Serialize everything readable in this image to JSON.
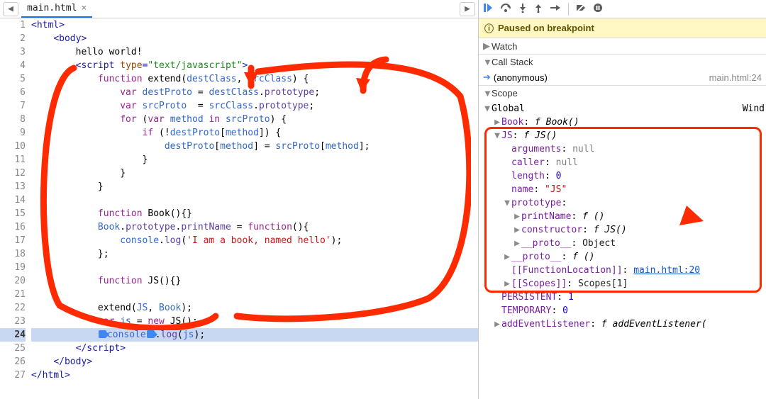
{
  "tab": {
    "filename": "main.html"
  },
  "banner": {
    "text": "Paused on breakpoint"
  },
  "sections": {
    "watch": "Watch",
    "callstack": "Call Stack",
    "scope": "Scope"
  },
  "callstack": {
    "frame_name": "(anonymous)",
    "frame_loc": "main.html:24"
  },
  "code": {
    "active_line": 24,
    "lines": [
      {
        "n": 1,
        "tokens": [
          [
            "c-tag",
            "<html>"
          ]
        ]
      },
      {
        "n": 2,
        "indent": 1,
        "tokens": [
          [
            "c-tag",
            "<body>"
          ]
        ]
      },
      {
        "n": 3,
        "indent": 2,
        "tokens": [
          [
            "c-pl",
            "hello world!"
          ]
        ]
      },
      {
        "n": 4,
        "indent": 2,
        "tokens": [
          [
            "c-tag",
            "<script "
          ],
          [
            "c-attr",
            "type"
          ],
          [
            "c-tag",
            "="
          ],
          [
            "c-str",
            "\"text/javascript\""
          ],
          [
            "c-tag",
            ">"
          ]
        ]
      },
      {
        "n": 5,
        "indent": 3,
        "tokens": [
          [
            "c-kw",
            "function "
          ],
          [
            "c-fn",
            "extend"
          ],
          [
            "c-pl",
            "("
          ],
          [
            "c-var",
            "destClass"
          ],
          [
            "c-pl",
            ", "
          ],
          [
            "c-var",
            "srcClass"
          ],
          [
            "c-pl",
            ") {"
          ]
        ]
      },
      {
        "n": 6,
        "indent": 4,
        "tokens": [
          [
            "c-kw",
            "var "
          ],
          [
            "c-var",
            "destProto"
          ],
          [
            "c-pl",
            " = "
          ],
          [
            "c-var",
            "destClass"
          ],
          [
            "c-pl",
            "."
          ],
          [
            "c-prop",
            "prototype"
          ],
          [
            "c-pl",
            ";"
          ]
        ]
      },
      {
        "n": 7,
        "indent": 4,
        "tokens": [
          [
            "c-kw",
            "var "
          ],
          [
            "c-var",
            "srcProto"
          ],
          [
            "c-pl",
            "  = "
          ],
          [
            "c-var",
            "srcClass"
          ],
          [
            "c-pl",
            "."
          ],
          [
            "c-prop",
            "prototype"
          ],
          [
            "c-pl",
            ";"
          ]
        ]
      },
      {
        "n": 8,
        "indent": 4,
        "tokens": [
          [
            "c-kw",
            "for "
          ],
          [
            "c-pl",
            "("
          ],
          [
            "c-kw",
            "var "
          ],
          [
            "c-var",
            "method"
          ],
          [
            "c-kw",
            " in "
          ],
          [
            "c-var",
            "srcProto"
          ],
          [
            "c-pl",
            ") {"
          ]
        ]
      },
      {
        "n": 9,
        "indent": 5,
        "tokens": [
          [
            "c-kw",
            "if "
          ],
          [
            "c-pl",
            "(!"
          ],
          [
            "c-var",
            "destProto"
          ],
          [
            "c-pl",
            "["
          ],
          [
            "c-var",
            "method"
          ],
          [
            "c-pl",
            "]) {"
          ]
        ]
      },
      {
        "n": 10,
        "indent": 6,
        "tokens": [
          [
            "c-var",
            "destProto"
          ],
          [
            "c-pl",
            "["
          ],
          [
            "c-var",
            "method"
          ],
          [
            "c-pl",
            "] = "
          ],
          [
            "c-var",
            "srcProto"
          ],
          [
            "c-pl",
            "["
          ],
          [
            "c-var",
            "method"
          ],
          [
            "c-pl",
            "];"
          ]
        ]
      },
      {
        "n": 11,
        "indent": 5,
        "tokens": [
          [
            "c-pl",
            "}"
          ]
        ]
      },
      {
        "n": 12,
        "indent": 4,
        "tokens": [
          [
            "c-pl",
            "}"
          ]
        ]
      },
      {
        "n": 13,
        "indent": 3,
        "tokens": [
          [
            "c-pl",
            "}"
          ]
        ]
      },
      {
        "n": 14,
        "indent": 0,
        "tokens": []
      },
      {
        "n": 15,
        "indent": 3,
        "tokens": [
          [
            "c-kw",
            "function "
          ],
          [
            "c-fn",
            "Book"
          ],
          [
            "c-pl",
            "(){}"
          ]
        ]
      },
      {
        "n": 16,
        "indent": 3,
        "tokens": [
          [
            "c-var",
            "Book"
          ],
          [
            "c-pl",
            "."
          ],
          [
            "c-prop",
            "prototype"
          ],
          [
            "c-pl",
            "."
          ],
          [
            "c-prop",
            "printName"
          ],
          [
            "c-pl",
            " = "
          ],
          [
            "c-kw",
            "function"
          ],
          [
            "c-pl",
            "(){"
          ]
        ]
      },
      {
        "n": 17,
        "indent": 4,
        "tokens": [
          [
            "c-var",
            "console"
          ],
          [
            "c-pl",
            "."
          ],
          [
            "c-prop",
            "log"
          ],
          [
            "c-pl",
            "("
          ],
          [
            "c-sstr",
            "'I am a book, named hello'"
          ],
          [
            "c-pl",
            ");"
          ]
        ]
      },
      {
        "n": 18,
        "indent": 3,
        "tokens": [
          [
            "c-pl",
            "};"
          ]
        ]
      },
      {
        "n": 19,
        "indent": 0,
        "tokens": []
      },
      {
        "n": 20,
        "indent": 3,
        "tokens": [
          [
            "c-kw",
            "function "
          ],
          [
            "c-fn",
            "JS"
          ],
          [
            "c-pl",
            "(){}"
          ]
        ]
      },
      {
        "n": 21,
        "indent": 0,
        "tokens": []
      },
      {
        "n": 22,
        "indent": 3,
        "tokens": [
          [
            "c-fn",
            "extend"
          ],
          [
            "c-pl",
            "("
          ],
          [
            "c-var",
            "JS"
          ],
          [
            "c-pl",
            ", "
          ],
          [
            "c-var",
            "Book"
          ],
          [
            "c-pl",
            ");"
          ]
        ]
      },
      {
        "n": 23,
        "indent": 3,
        "tokens": [
          [
            "c-kw",
            "var "
          ],
          [
            "c-var",
            "js"
          ],
          [
            "c-pl",
            " = "
          ],
          [
            "c-kw",
            "new "
          ],
          [
            "c-fn",
            "JS"
          ],
          [
            "c-pl",
            "();"
          ]
        ]
      },
      {
        "n": 24,
        "indent": 3,
        "bp": true,
        "tokens": [
          [
            "c-var",
            "console"
          ],
          [
            "c-pl",
            "."
          ],
          [
            "c-prop",
            "log"
          ],
          [
            "c-pl",
            "("
          ],
          [
            "c-var",
            "js"
          ],
          [
            "c-pl",
            ");"
          ]
        ]
      },
      {
        "n": 25,
        "indent": 2,
        "tokens": [
          [
            "c-tag",
            "</script"
          ],
          [
            "c-tag",
            ">"
          ]
        ]
      },
      {
        "n": 26,
        "indent": 1,
        "tokens": [
          [
            "c-tag",
            "</body>"
          ]
        ]
      },
      {
        "n": 27,
        "indent": 0,
        "tokens": [
          [
            "c-tag",
            "</html>"
          ]
        ]
      }
    ]
  },
  "scope": {
    "global_label": "Global",
    "global_type": "Wind",
    "rows": [
      {
        "d": 1,
        "tri": "▶",
        "name": "Book",
        "sep": ": ",
        "val": "f Book()",
        "valcls": "k-val-fn"
      },
      {
        "d": 1,
        "tri": "▼",
        "name": "JS",
        "sep": ": ",
        "val": "f JS()",
        "valcls": "k-val-fn"
      },
      {
        "d": 2,
        "tri": "",
        "name": "arguments",
        "sep": ": ",
        "val": "null",
        "valcls": "k-val-null"
      },
      {
        "d": 2,
        "tri": "",
        "name": "caller",
        "sep": ": ",
        "val": "null",
        "valcls": "k-val-null"
      },
      {
        "d": 2,
        "tri": "",
        "name": "length",
        "sep": ": ",
        "val": "0",
        "valcls": "k-val-num"
      },
      {
        "d": 2,
        "tri": "",
        "name": "name",
        "sep": ": ",
        "val": "\"JS\"",
        "valcls": "k-val-str"
      },
      {
        "d": 2,
        "tri": "▼",
        "name": "prototype",
        "sep": ":",
        "val": "",
        "valcls": "k-val-plain"
      },
      {
        "d": 3,
        "tri": "▶",
        "name": "printName",
        "sep": ": ",
        "val": "f ()",
        "valcls": "k-val-fn"
      },
      {
        "d": 3,
        "tri": "▶",
        "name": "constructor",
        "sep": ": ",
        "val": "f JS()",
        "valcls": "k-val-fn"
      },
      {
        "d": 3,
        "tri": "▶",
        "name": "__proto__",
        "sep": ": ",
        "val": "Object",
        "valcls": "k-val-plain"
      },
      {
        "d": 2,
        "tri": "▶",
        "name": "__proto__",
        "sep": ": ",
        "val": "f ()",
        "valcls": "k-val-fn"
      },
      {
        "d": 2,
        "tri": "",
        "name": "[[FunctionLocation]]",
        "sep": ": ",
        "val": "main.html:20",
        "valcls": "k-val-link"
      },
      {
        "d": 2,
        "tri": "▶",
        "name": "[[Scopes]]",
        "sep": ": ",
        "val": "Scopes[1]",
        "valcls": "k-val-plain"
      },
      {
        "d": 1,
        "tri": "",
        "name": "PERSISTENT",
        "sep": ": ",
        "val": "1",
        "valcls": "k-val-num"
      },
      {
        "d": 1,
        "tri": "",
        "name": "TEMPORARY",
        "sep": ": ",
        "val": "0",
        "valcls": "k-val-num"
      },
      {
        "d": 1,
        "tri": "▶",
        "name": "addEventListener",
        "sep": ": ",
        "val": "f addEventListener(",
        "valcls": "k-val-fn"
      }
    ]
  }
}
